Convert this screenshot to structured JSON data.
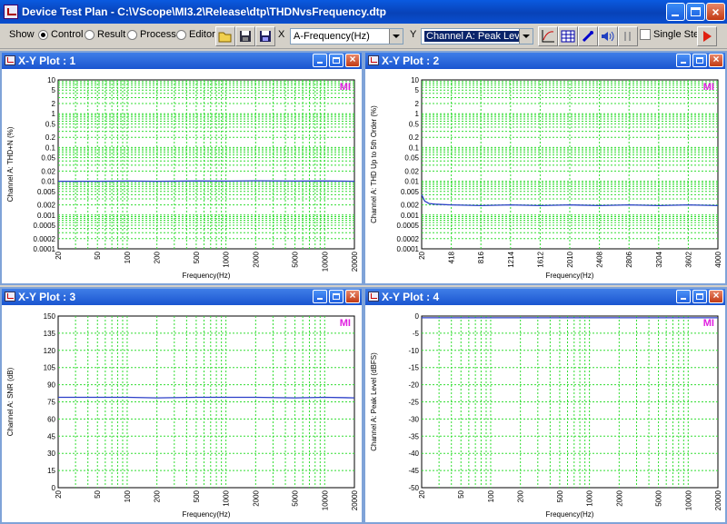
{
  "window": {
    "title": "Device Test Plan - C:\\VScope\\MI3.2\\Release\\dtp\\THDNvsFrequency.dtp"
  },
  "toolbar": {
    "show_label": "Show",
    "modes": [
      "Control",
      "Result",
      "Process",
      "Editor"
    ],
    "selected_mode": "Control",
    "x_label": "X",
    "x_value": "A-Frequency(Hz)",
    "y_label": "Y",
    "y_value": "Channel A: Peak Level (dBFS",
    "single_step_label": "Single Step",
    "single_step_checked": false,
    "icons": [
      "open-folder-icon",
      "save-icon",
      "save-as-icon",
      "plot-axis-icon",
      "table-icon",
      "probe-icon",
      "speaker-icon",
      "pause-icon",
      "run-icon"
    ]
  },
  "colors": {
    "grid": "#33dd33",
    "trace": "#2b3fc8",
    "badge": "#e020e0",
    "title_bar": "#1a55d0"
  },
  "plots": [
    {
      "title": "X-Y Plot : 1",
      "badge": "MI",
      "ylabel": "Channel A: THD+N (%)",
      "xlabel": "Frequency(Hz)",
      "x_ticks": [
        "20",
        "50",
        "100",
        "200",
        "500",
        "1000",
        "2000",
        "5000",
        "10000",
        "20000"
      ],
      "y_ticks": [
        "10",
        "5",
        "2",
        "1",
        "0.5",
        "0.2",
        "0.1",
        "0.05",
        "0.02",
        "0.01",
        "0.005",
        "0.002",
        "0.001",
        "0.0005",
        "0.0002",
        "0.0001"
      ]
    },
    {
      "title": "X-Y Plot : 2",
      "badge": "MI",
      "ylabel": "Channel A: THD Up to 5th Order (%)",
      "xlabel": "Frequency(Hz)",
      "x_ticks": [
        "20",
        "418",
        "816",
        "1214",
        "1612",
        "2010",
        "2408",
        "2806",
        "3204",
        "3602",
        "4000"
      ],
      "y_ticks": [
        "10",
        "5",
        "2",
        "1",
        "0.5",
        "0.2",
        "0.1",
        "0.05",
        "0.02",
        "0.01",
        "0.005",
        "0.002",
        "0.001",
        "0.0005",
        "0.0002",
        "0.0001"
      ]
    },
    {
      "title": "X-Y Plot : 3",
      "badge": "MI",
      "ylabel": "Channel A: SNR (dB)",
      "xlabel": "Frequency(Hz)",
      "x_ticks": [
        "20",
        "50",
        "100",
        "200",
        "500",
        "1000",
        "2000",
        "5000",
        "10000",
        "20000"
      ],
      "y_ticks": [
        "150",
        "135",
        "120",
        "105",
        "90",
        "75",
        "60",
        "45",
        "30",
        "15",
        "0"
      ]
    },
    {
      "title": "X-Y Plot : 4",
      "badge": "MI",
      "ylabel": "Channel A: Peak Level (dBFS)",
      "xlabel": "Frequency(Hz)",
      "x_ticks": [
        "20",
        "50",
        "100",
        "200",
        "500",
        "1000",
        "2000",
        "5000",
        "10000",
        "20000"
      ],
      "y_ticks": [
        "0",
        "-5",
        "-10",
        "-15",
        "-20",
        "-25",
        "-30",
        "-35",
        "-40",
        "-45",
        "-50"
      ]
    }
  ],
  "chart_data": [
    {
      "type": "line",
      "title": "X-Y Plot : 1",
      "xlabel": "Frequency(Hz)",
      "ylabel": "Channel A: THD+N (%)",
      "xscale": "log",
      "yscale": "log",
      "xlim": [
        20,
        20000
      ],
      "ylim": [
        0.0001,
        10
      ],
      "grid": true,
      "series": [
        {
          "x": [
            20,
            50,
            100,
            200,
            500,
            1000,
            2000,
            5000,
            10000,
            20000
          ],
          "y": [
            0.01,
            0.01,
            0.0101,
            0.01,
            0.0102,
            0.0101,
            0.0103,
            0.0101,
            0.0102,
            0.01
          ]
        }
      ]
    },
    {
      "type": "line",
      "title": "X-Y Plot : 2",
      "xlabel": "Frequency(Hz)",
      "ylabel": "Channel A: THD Up to 5th Order (%)",
      "xscale": "linear",
      "yscale": "log",
      "xlim": [
        20,
        4000
      ],
      "ylim": [
        0.0001,
        10
      ],
      "grid": true,
      "series": [
        {
          "x": [
            20,
            60,
            120,
            200,
            418,
            816,
            1214,
            1612,
            2010,
            2408,
            2806,
            3204,
            3602,
            4000
          ],
          "y": [
            0.004,
            0.0026,
            0.0022,
            0.0021,
            0.002,
            0.0019,
            0.002,
            0.0019,
            0.002,
            0.0019,
            0.002,
            0.0019,
            0.002,
            0.0019
          ]
        }
      ]
    },
    {
      "type": "line",
      "title": "X-Y Plot : 3",
      "xlabel": "Frequency(Hz)",
      "ylabel": "Channel A: SNR (dB)",
      "xscale": "log",
      "yscale": "linear",
      "xlim": [
        20,
        20000
      ],
      "ylim": [
        0,
        150
      ],
      "grid": true,
      "series": [
        {
          "x": [
            20,
            50,
            100,
            200,
            500,
            1000,
            2000,
            5000,
            10000,
            20000
          ],
          "y": [
            79,
            79,
            79,
            78.5,
            79,
            79,
            79,
            78.5,
            79,
            78.5
          ]
        }
      ]
    },
    {
      "type": "line",
      "title": "X-Y Plot : 4",
      "xlabel": "Frequency(Hz)",
      "ylabel": "Channel A: Peak Level (dBFS)",
      "xscale": "log",
      "yscale": "linear",
      "xlim": [
        20,
        20000
      ],
      "ylim": [
        -50,
        0
      ],
      "grid": true,
      "series": [
        {
          "x": [
            20,
            50,
            100,
            200,
            500,
            1000,
            2000,
            5000,
            10000,
            20000
          ],
          "y": [
            -0.5,
            -0.5,
            -0.5,
            -0.5,
            -0.5,
            -0.5,
            -0.5,
            -0.5,
            -0.5,
            -0.5
          ]
        }
      ]
    }
  ]
}
